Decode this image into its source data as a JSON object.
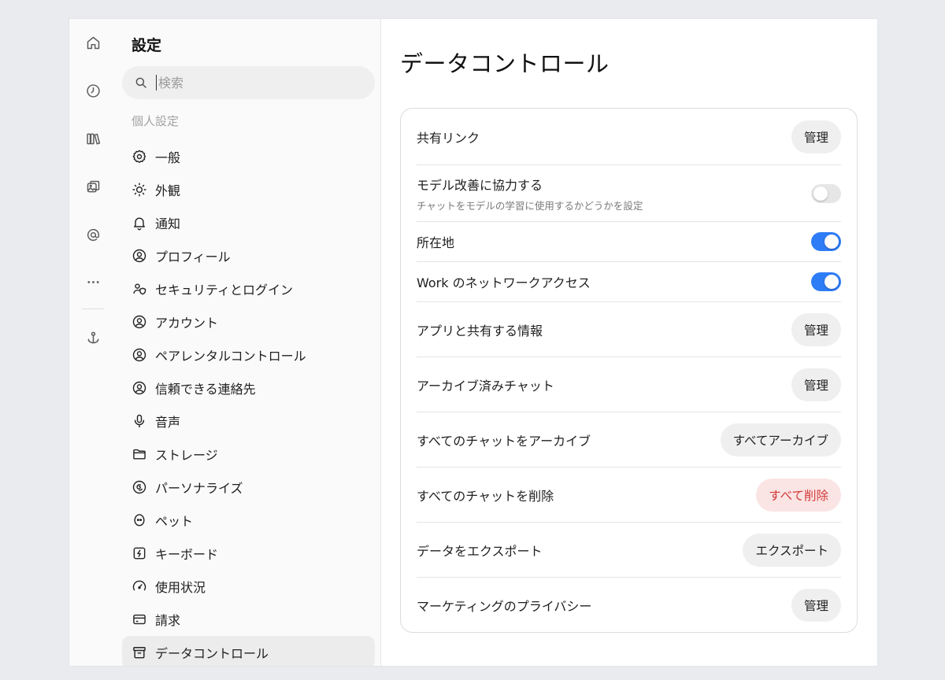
{
  "rail": {
    "items": [
      {
        "name": "home-icon"
      },
      {
        "name": "history-icon"
      },
      {
        "name": "library-icon"
      },
      {
        "name": "images-icon"
      },
      {
        "name": "at-sign-icon"
      },
      {
        "name": "more-icon"
      },
      {
        "name": "anchor-icon"
      }
    ]
  },
  "sidebar": {
    "title": "設定",
    "search_placeholder": "検索",
    "section_label": "個人設定",
    "items": [
      {
        "label": "一般",
        "icon": "gear-icon"
      },
      {
        "label": "外観",
        "icon": "sun-icon"
      },
      {
        "label": "通知",
        "icon": "bell-icon"
      },
      {
        "label": "プロフィール",
        "icon": "profile-icon"
      },
      {
        "label": "セキュリティとログイン",
        "icon": "shield-person-icon"
      },
      {
        "label": "アカウント",
        "icon": "account-icon"
      },
      {
        "label": "ペアレンタルコントロール",
        "icon": "family-icon"
      },
      {
        "label": "信頼できる連絡先",
        "icon": "contact-icon"
      },
      {
        "label": "音声",
        "icon": "microphone-icon"
      },
      {
        "label": "ストレージ",
        "icon": "folder-icon"
      },
      {
        "label": "パーソナライズ",
        "icon": "personalize-icon"
      },
      {
        "label": "ペット",
        "icon": "pet-icon"
      },
      {
        "label": "キーボード",
        "icon": "keyboard-icon"
      },
      {
        "label": "使用状況",
        "icon": "gauge-icon"
      },
      {
        "label": "請求",
        "icon": "credit-card-icon"
      },
      {
        "label": "データコントロール",
        "icon": "archive-box-icon",
        "active": true
      }
    ]
  },
  "main": {
    "title": "データコントロール",
    "rows": [
      {
        "label": "共有リンク",
        "control": "button",
        "button": "管理"
      },
      {
        "label": "モデル改善に協力する",
        "sub": "チャットをモデルの学習に使用するかどうかを設定",
        "control": "toggle",
        "on": false
      },
      {
        "label": "所在地",
        "control": "toggle",
        "on": true
      },
      {
        "label": "Work のネットワークアクセス",
        "control": "toggle",
        "on": true
      },
      {
        "label": "アプリと共有する情報",
        "control": "button",
        "button": "管理"
      },
      {
        "label": "アーカイブ済みチャット",
        "control": "button",
        "button": "管理"
      },
      {
        "label": "すべてのチャットをアーカイブ",
        "control": "button",
        "button": "すべてアーカイブ"
      },
      {
        "label": "すべてのチャットを削除",
        "control": "button",
        "button": "すべて削除",
        "danger": true
      },
      {
        "label": "データをエクスポート",
        "control": "button",
        "button": "エクスポート"
      },
      {
        "label": "マーケティングのプライバシー",
        "control": "button",
        "button": "管理"
      }
    ]
  },
  "colors": {
    "toggle_on": "#2e7cf6",
    "danger_text": "#d33a3a",
    "danger_bg": "#fbe4e4"
  }
}
